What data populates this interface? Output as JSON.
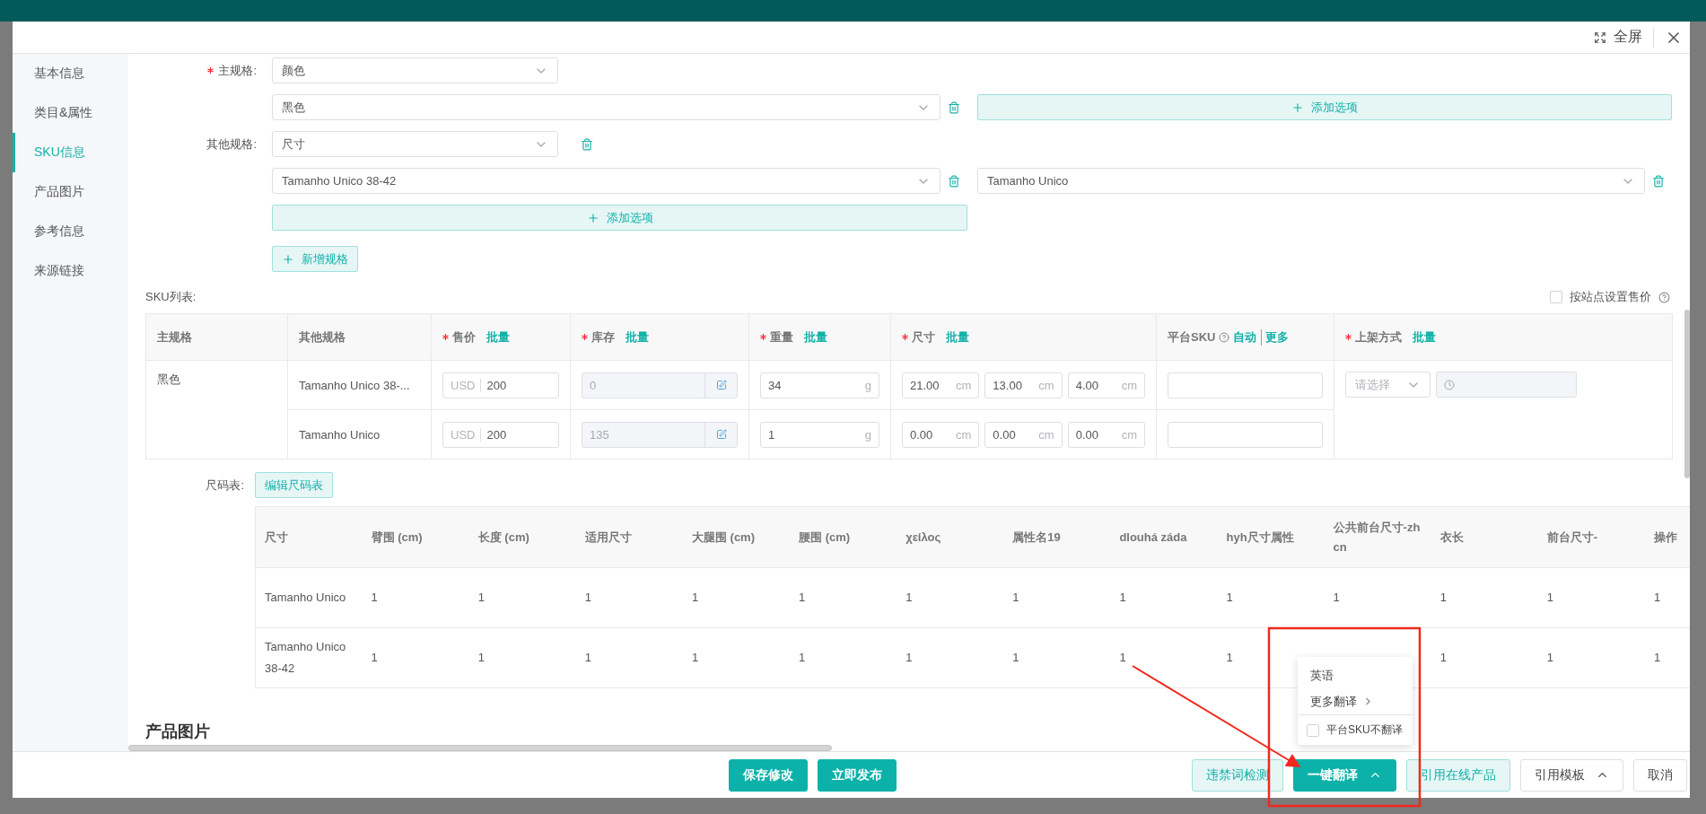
{
  "dialog": {
    "fullscreen_label": "全屏"
  },
  "sidebar": {
    "items": [
      {
        "label": "基本信息",
        "selected": false
      },
      {
        "label": "类目&属性",
        "selected": false
      },
      {
        "label": "SKU信息",
        "selected": true
      },
      {
        "label": "产品图片",
        "selected": false
      },
      {
        "label": "参考信息",
        "selected": false
      },
      {
        "label": "来源链接",
        "selected": false
      }
    ]
  },
  "specs": [
    {
      "label": "主规格:",
      "required": true,
      "value": "颜色",
      "removable": false,
      "options": [
        "黑色"
      ],
      "add_option": "添加选项"
    },
    {
      "label": "其他规格:",
      "required": false,
      "value": "尺寸",
      "removable": true,
      "options": [
        "Tamanho Unico 38-42",
        "Tamanho Unico"
      ],
      "add_option": "添加选项"
    }
  ],
  "add_spec": "新增规格",
  "sku_list": {
    "label": "SKU列表:",
    "site_price": {
      "label": "按站点设置售价",
      "checked": false
    },
    "columns": [
      {
        "label": "主规格",
        "required": false
      },
      {
        "label": "其他规格",
        "required": false
      },
      {
        "label": "售价",
        "required": true,
        "links": [
          "批量"
        ]
      },
      {
        "label": "库存",
        "required": true,
        "links": [
          "批量"
        ]
      },
      {
        "label": "重量",
        "required": true,
        "links": [
          "批量"
        ]
      },
      {
        "label": "尺寸",
        "required": true,
        "links": [
          "批量"
        ]
      },
      {
        "label": "平台SKU",
        "required": false,
        "help": true,
        "links": [
          "自动",
          "更多"
        ]
      },
      {
        "label": "上架方式",
        "required": true,
        "links": [
          "批量"
        ]
      }
    ],
    "main_spec": "黑色",
    "rows": [
      {
        "other_spec": "Tamanho Unico 38-...",
        "price": {
          "currency": "USD",
          "value": "200"
        },
        "stock": {
          "value": "0",
          "disabled": true
        },
        "weight": {
          "value": "34",
          "unit": "g"
        },
        "size": [
          {
            "value": "21.00",
            "unit": "cm"
          },
          {
            "value": "13.00",
            "unit": "cm"
          },
          {
            "value": "4.00",
            "unit": "cm"
          }
        ]
      },
      {
        "other_spec": "Tamanho Unico",
        "price": {
          "currency": "USD",
          "value": "200"
        },
        "stock": {
          "value": "135",
          "disabled": true
        },
        "weight": {
          "value": "1",
          "unit": "g"
        },
        "size": [
          {
            "value": "0.00",
            "unit": "cm"
          },
          {
            "value": "0.00",
            "unit": "cm"
          },
          {
            "value": "0.00",
            "unit": "cm"
          }
        ]
      }
    ],
    "listing": {
      "placeholder": "请选择",
      "time_disabled": true
    }
  },
  "size_chart": {
    "label": "尺码表:",
    "edit_button": "编辑尺码表",
    "columns": [
      "尺寸",
      "臂围 (cm)",
      "长度 (cm)",
      "适用尺寸",
      "大腿围 (cm)",
      "腰围 (cm)",
      "χείλος",
      "属性名19",
      "dlouhá záda",
      "hyh尺寸属性",
      "公共前台尺寸-zhcn",
      "衣长",
      "前台尺寸-",
      "操作"
    ],
    "rows": [
      [
        "Tamanho Unico",
        "1",
        "1",
        "1",
        "1",
        "1",
        "1",
        "1",
        "1",
        "1",
        "1",
        "1",
        "1",
        "1"
      ],
      [
        "Tamanho Unico 38-42",
        "1",
        "1",
        "1",
        "1",
        "1",
        "1",
        "1",
        "1",
        "1",
        null,
        "1",
        "1",
        "1"
      ]
    ]
  },
  "next_section": "产品图片",
  "footer": {
    "left": [
      {
        "label": "保存修改",
        "kind": "primary"
      },
      {
        "label": "立即发布",
        "kind": "primary"
      }
    ],
    "right": [
      {
        "label": "违禁词检测",
        "kind": "light",
        "caret": false
      },
      {
        "label": "一键翻译",
        "kind": "primary",
        "caret": true
      },
      {
        "label": "引用在线产品",
        "kind": "light",
        "caret": false
      },
      {
        "label": "引用模板",
        "kind": "default",
        "caret": true
      },
      {
        "label": "取消",
        "kind": "default",
        "caret": false
      }
    ]
  },
  "translate_menu": {
    "items": [
      {
        "label": "英语",
        "kind": "item"
      },
      {
        "label": "更多翻译",
        "kind": "submenu"
      }
    ],
    "option": {
      "label": "平台SKU不翻译",
      "checked": false
    }
  }
}
